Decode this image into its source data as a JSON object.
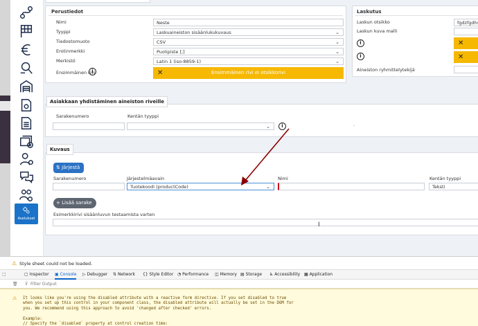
{
  "sidebar": {
    "active_label": "Asetukset"
  },
  "perustiedot": {
    "title": "Perustiedot",
    "rows": [
      {
        "label": "Nimi",
        "value": "Neste"
      },
      {
        "label": "Tyyppi",
        "value": "Laskuaineiston sisäänlukukuvaus"
      },
      {
        "label": "Tiedostomuoto",
        "value": "CSV"
      },
      {
        "label": "Erotinmerkki",
        "value": "Puolipiste [;]"
      },
      {
        "label": "Merkistö",
        "value": "Latin 1 (iso-8859-1)"
      },
      {
        "label": "Ensimmäinen rivi",
        "value": ""
      }
    ],
    "warning": "Ensimmäinen rivi ei otsikkorivi"
  },
  "laskutus": {
    "title": "Laskutus",
    "rows": [
      {
        "label": "Laskun otsikko",
        "value": "fgdzfgdhs"
      },
      {
        "label": "Laskun kuva malli",
        "value": ""
      },
      {
        "label": "Aineiston ryhmittelytekijä",
        "value": ""
      }
    ]
  },
  "asiakas": {
    "title": "Asiakkaan yhdistäminen aineiston riveille",
    "col1": "Sarakenumero",
    "col2": "Kentän tyyppi",
    "dot": "."
  },
  "kuvaus": {
    "title": "Kuvaus",
    "sort_button": "Järjestä",
    "col_sarakenumero": "Sarakenumero",
    "col_jarjestelmaavain": "Järjestelmäavain",
    "col_nimi": "Nimi",
    "col_kentan_tyyppi": "Kentän tyyppi",
    "row_jarjestelmaavain": "Tuotekoodi (productCode)",
    "row_kentan_tyyppi": "Teksti",
    "add_button": "Lisää sarake",
    "sample_label": "Esimerkkirivi sisäänluvun testaamista varten"
  },
  "devtools": {
    "warning": "Style sheet could not be loaded.",
    "tabs": [
      "Inspector",
      "Console",
      "Debugger",
      "Network",
      "Style Editor",
      "Performance",
      "Memory",
      "Storage",
      "Accessibility",
      "Application"
    ],
    "active_tab": "Console",
    "filter_placeholder": "Filter Output",
    "console_text": "It looks like you're using the disabled attribute with a reactive form directive. If you set disabled to true\nwhen you set up this control in your component class, the disabled attribute will actually be set in the DOM for\nyou. We recommend using this approach to avoid 'changed after checked' errors.\n\nExample:\n// Specify the `disabled` property at control creation time:\nform = new FormGroup({"
  },
  "colors": {
    "accent": "#1a73c8",
    "warning": "#f6b800",
    "arrow": "#8b0000"
  }
}
